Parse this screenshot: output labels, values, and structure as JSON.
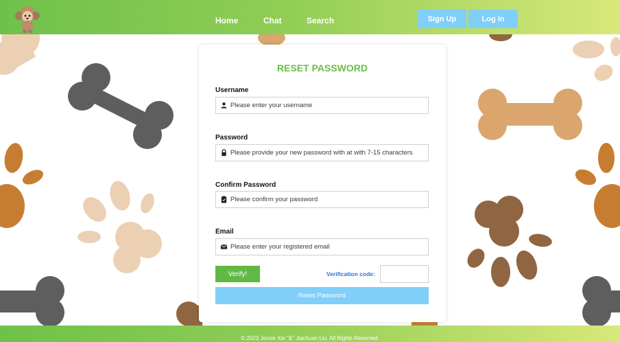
{
  "header": {
    "nav": {
      "home": "Home",
      "chat": "Chat",
      "search": "Search"
    },
    "sign_up": "Sign Up",
    "log_in": "Log In"
  },
  "form": {
    "title": "RESET PASSWORD",
    "username": {
      "label": "Username",
      "placeholder": "Please enter your username",
      "icon": "user-icon"
    },
    "password": {
      "label": "Password",
      "placeholder": "Please provide your new password with at with 7-15 characters",
      "icon": "lock-icon"
    },
    "confirm_password": {
      "label": "Confirm Password",
      "placeholder": "Please confirm your password",
      "icon": "clipboard-icon"
    },
    "email": {
      "label": "Email",
      "placeholder": "Please enter your registered email",
      "icon": "envelope-icon"
    },
    "verify_label": "Verify!",
    "verification_code_label": "Verification code:",
    "reset_label": "Reset Password"
  },
  "footer": {
    "text": "© 2023 Jessie Xie \"&\" Jiachuan Liu. All Rights Reserved."
  },
  "colors": {
    "brand_green": "#6abd45",
    "button_green": "#5fb944",
    "button_blue": "#7fcff9",
    "link_blue": "#2f6fd6",
    "bone_dark": "#5e5e5e",
    "bone_tan": "#dba66d",
    "paw_brown": "#8f6641",
    "paw_orange": "#c77d31",
    "paw_beige": "#ecd0b3"
  }
}
